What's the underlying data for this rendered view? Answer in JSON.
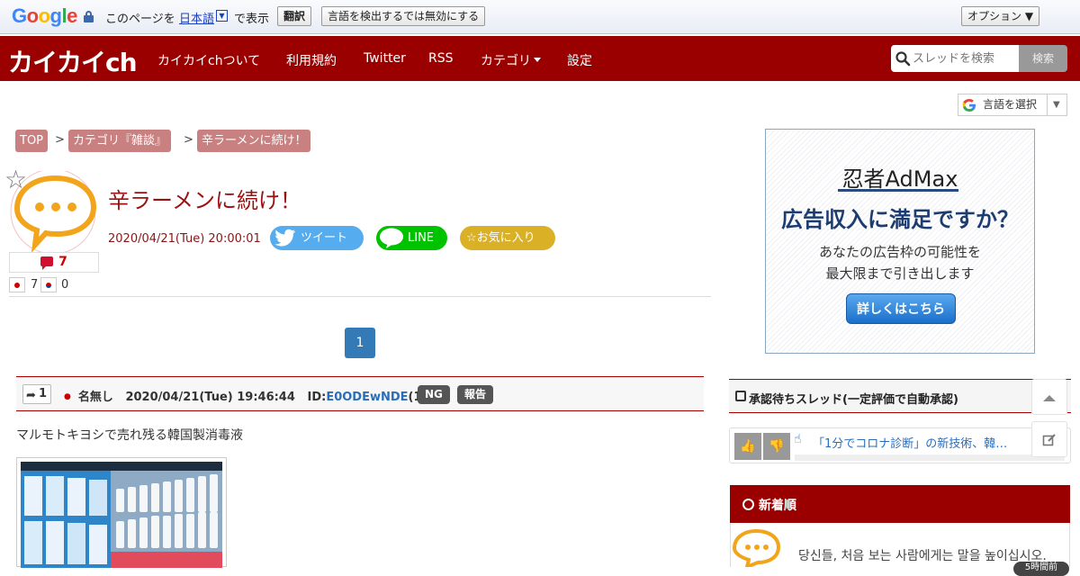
{
  "translate_bar": {
    "logo": "Google",
    "prefix": "このページを",
    "language": "日本語",
    "dropdown_glyph": "▼",
    "suffix": "で表示",
    "translate_button": "翻訳",
    "disable_button": "言語を検出するでは無効にする",
    "options_button": "オプション ▼"
  },
  "header": {
    "logo": "カイカイch",
    "nav": [
      "カイカイchついて",
      "利用規約",
      "Twitter",
      "RSS",
      "カテゴリ",
      "設定"
    ],
    "search_placeholder": "スレッドを検索",
    "search_button": "検索"
  },
  "language_select": {
    "label": "言語を選択",
    "arrow": "▼"
  },
  "breadcrumb": [
    "TOP",
    "カテゴリ『雑談』",
    "辛ラーメンに続け！"
  ],
  "breadcrumb_separator": ">",
  "thread": {
    "favorite_star": "☆",
    "response_count": "7",
    "jp_count": "7",
    "kr_count": "0",
    "title": "辛ラーメンに続け！",
    "datetime": "2020/04/21(Tue) 20:00:01",
    "tweet_label": "ツイート",
    "line_label": "LINE",
    "favorite_label": "☆お気に入り"
  },
  "pagination": {
    "current": "1"
  },
  "post": {
    "number": "1",
    "name": "名無し",
    "datetime": "2020/04/21(Tue) 19:46:44",
    "id_label": "ID:",
    "id_value": "E0ODEwNDE",
    "id_count": "(1/1)",
    "ng_button": "NG",
    "report_button": "報告",
    "body": "マルモトキヨシで売れ残る韓国製消毒液"
  },
  "ad": {
    "brand": "忍者AdMax",
    "headline": "広告収入に満足ですか？",
    "line1": "あなたの広告枠の可能性を",
    "line2": "最大限まで引き出します",
    "cta": "詳しくはこちら"
  },
  "pending": {
    "title": "承認待ちスレッド(一定評価で自動承認)",
    "item_text": "「1分でコロナ診断」の新技術、韓…"
  },
  "newest": {
    "title": "新着順",
    "item_text": "당신들, 처음 보는 사람에게는 말을 높이십시오.",
    "badge": "5時間前"
  },
  "colors": {
    "brand_red": "#9b0000",
    "breadcrumb": "#c98080",
    "link_blue": "#2a6ebb",
    "pager_blue": "#337ab7"
  },
  "icons": [
    "lock-icon",
    "search-icon",
    "star-icon",
    "comment-icon",
    "twitter-bird-icon",
    "line-icon",
    "reply-arrow-icon",
    "check-square-icon",
    "thumbs-up-icon",
    "thumbs-down-icon",
    "pointer-icon",
    "clock-icon",
    "chevron-up-icon",
    "edit-icon"
  ]
}
